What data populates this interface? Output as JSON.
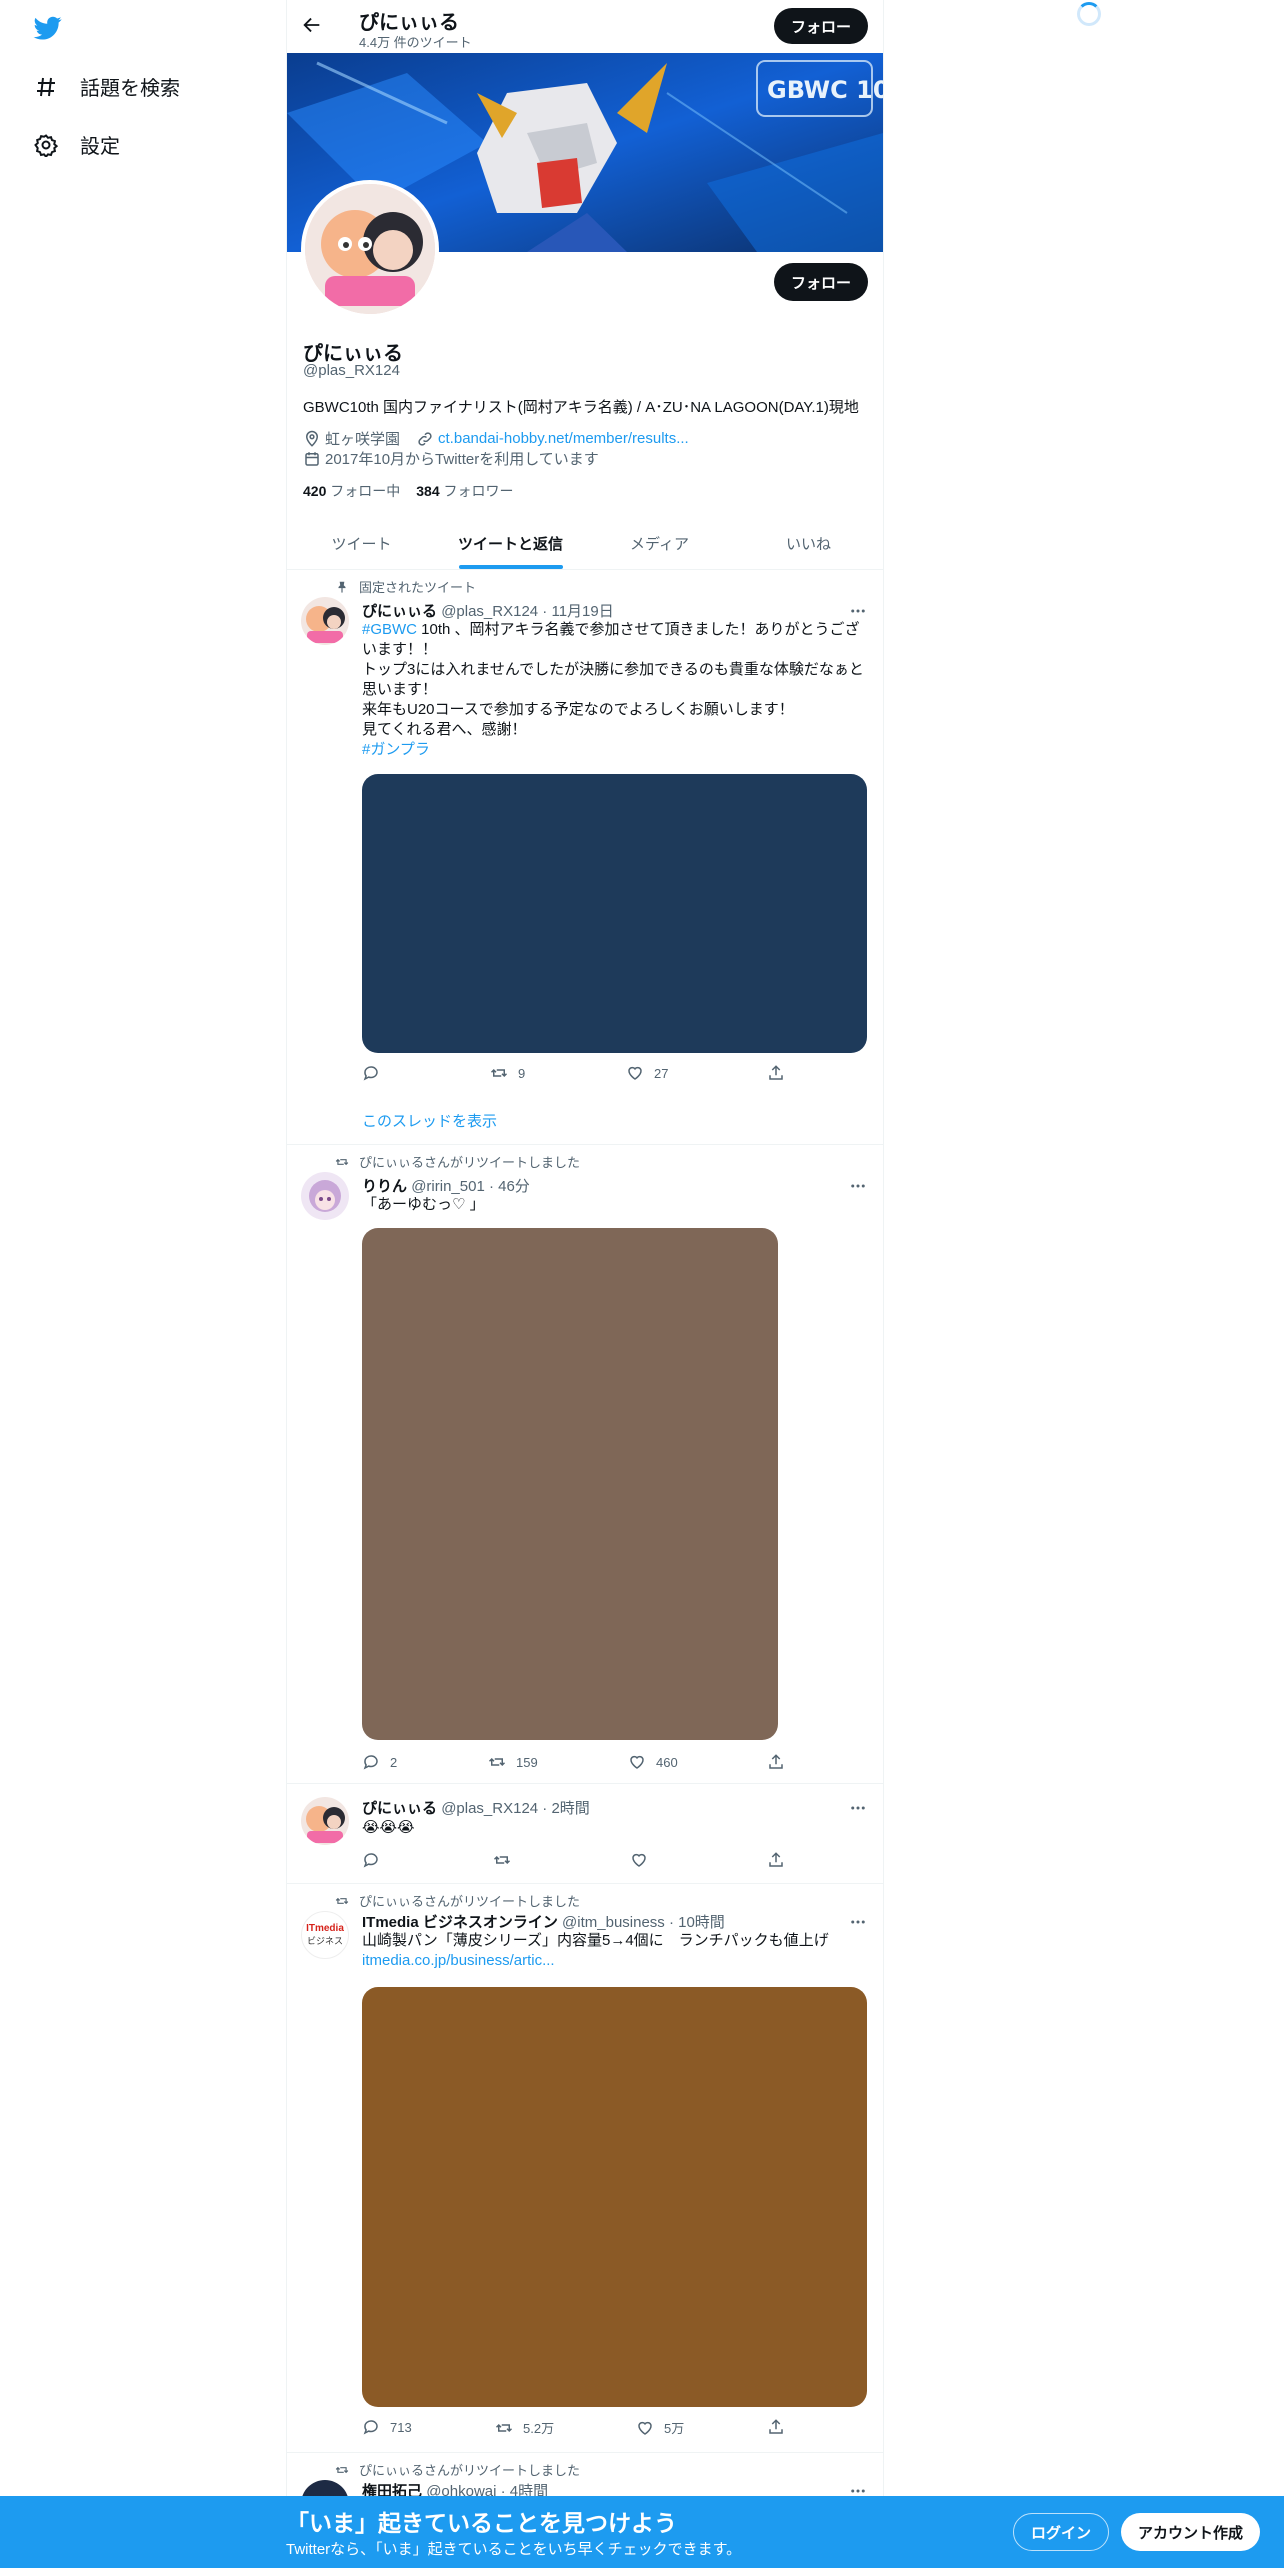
{
  "nav": {
    "explore_label": "話題を検索",
    "settings_label": "設定"
  },
  "header": {
    "name": "ぴにぃぃる",
    "tweet_count": "4.4万 件のツイート",
    "follow_label": "フォロー"
  },
  "profile": {
    "name": "ぴにぃぃる",
    "handle": "@plas_RX124",
    "bio": "GBWC10th 国内ファイナリスト(岡村アキラ名義) / A･ZU･NA LAGOON(DAY.1)現地",
    "location": "虹ヶ咲学園",
    "url": "ct.bandai-hobby.net/member/results...",
    "joined": "2017年10月からTwitterを利用しています",
    "following_count": "420",
    "following_label": "フォロー中",
    "followers_count": "384",
    "followers_label": "フォロワー",
    "follow_label": "フォロー",
    "banner_text": "GBWC 10"
  },
  "tabs": [
    {
      "label": "ツイート"
    },
    {
      "label": "ツイートと返信"
    },
    {
      "label": "メディア"
    },
    {
      "label": "いいね"
    }
  ],
  "tweets": [
    {
      "context": "固定されたツイート",
      "name": "ぴにぃぃる",
      "meta": "@plas_RX124 · 11月19日",
      "hashtag1": "#GBWC",
      "text1": " 10th 、岡村アキラ名義で参加させて頂きました！ありがとうございます！！",
      "text2": "トップ3には入れませんでしたが決勝に参加できるのも貴重な体験だなぁと思います！",
      "text3": "来年もU20コースで参加する予定なのでよろしくお願いします！",
      "text4": "見てくれる君へ、感謝！",
      "hashtag2": "#ガンプラ",
      "media_color": "#1e3a5a",
      "replies": "",
      "retweets": "9",
      "likes": "27",
      "show_thread": "このスレッドを表示"
    },
    {
      "context": "ぴにぃぃるさんがリツイートしました",
      "name": "りりん",
      "meta": "@ririn_501 · 46分",
      "text1": "「あーゆむっ♡ 」",
      "media_color": "#7f6757",
      "replies": "2",
      "retweets": "159",
      "likes": "460"
    },
    {
      "name": "ぴにぃぃる",
      "meta": "@plas_RX124 · 2時間",
      "text1": "😭😭😭",
      "replies": "",
      "retweets": "",
      "likes": ""
    },
    {
      "context": "ぴにぃぃるさんがリツイートしました",
      "name": "ITmedia ビジネスオンライン",
      "meta": "@itm_business · 10時間",
      "text1": "山崎製パン「薄皮シリーズ」内容量5→4個に　ランチパックも値上げ",
      "link": "itmedia.co.jp/business/artic...",
      "avatar_text1": "ITmedia",
      "avatar_text2": "ビジネス",
      "media_color": "#8b5a26",
      "replies": "713",
      "retweets": "5.2万",
      "likes": "5万"
    },
    {
      "context": "ぴにぃぃるさんがリツイートしました",
      "name": "権田拓己",
      "meta": "@ohkowai · 4時間"
    }
  ],
  "bottom_bar": {
    "title": "「いま」起きていることを見つけよう",
    "subtitle": "Twitterなら、「いま」起きていることをいち早くチェックできます。",
    "login": "ログイン",
    "signup": "アカウント作成"
  },
  "colors": {
    "accent": "#1d9bf0",
    "text": "#0f1419",
    "secondary": "#536471"
  }
}
